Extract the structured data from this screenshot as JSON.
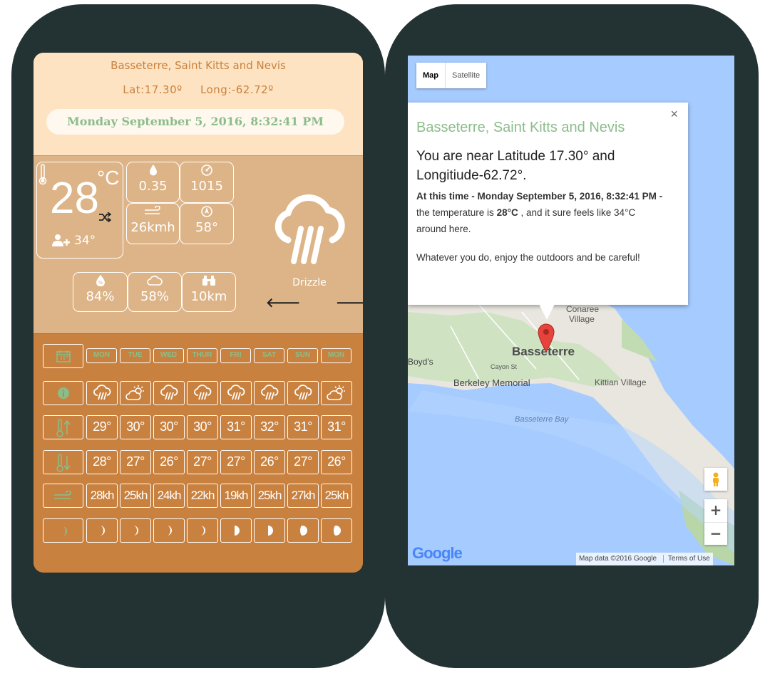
{
  "weather": {
    "location": "Basseterre, Saint Kitts and Nevis",
    "lat": "Lat:17.30º",
    "long": "Long:-62.72º",
    "datetime": "Monday September 5, 2016, 8:32:41 PM",
    "temperature": "28",
    "temp_unit": "°C",
    "feels_like": "34°",
    "precip": "0.35",
    "pressure": "1015",
    "wind_speed": "26kmh",
    "wind_dir": "58°",
    "humidity": "84%",
    "cloud_cover": "58%",
    "visibility": "10km",
    "condition": "Drizzle",
    "nav": {
      "prev": "🡐",
      "next": "🡒"
    }
  },
  "forecast": {
    "days": [
      "MON",
      "TUE",
      "WED",
      "THUR",
      "FRI",
      "SAT",
      "SUN",
      "MON"
    ],
    "icons": [
      "drizzle",
      "drizzle",
      "partly-cloudy",
      "drizzle",
      "drizzle",
      "drizzle",
      "drizzle",
      "drizzle",
      "partly-cloudy"
    ],
    "highs": [
      "29°",
      "30°",
      "30°",
      "30°",
      "31°",
      "32°",
      "31°",
      "31°"
    ],
    "lows": [
      "28°",
      "27°",
      "26°",
      "27°",
      "27°",
      "26°",
      "27°",
      "26°"
    ],
    "winds": [
      "28kh",
      "25kh",
      "24kh",
      "22kh",
      "19kh",
      "25kh",
      "27kh",
      "25kh"
    ],
    "moons": [
      "waxing-crescent",
      "waxing-crescent",
      "waxing-crescent",
      "waxing-crescent",
      "first-quarter",
      "first-quarter",
      "waxing-gibbous",
      "waxing-gibbous"
    ]
  },
  "map": {
    "type_map": "Map",
    "type_satellite": "Satellite",
    "info_title": "Basseterre, Saint Kitts and Nevis",
    "info_near": "You are near Latitude 17.30° and Longitiude-62.72°.",
    "info_bold": "At this time - Monday September 5, 2016, 8:32:41 PM -",
    "info_mid": " the temperature is ",
    "info_temp": "28°C",
    "info_end": " , and it sure feels like 34°C around here.",
    "info_para2": "Whatever you do, enjoy the outdoors and be careful!",
    "close": "×",
    "places": {
      "conaree": "Conaree",
      "village": "Village",
      "basseterre": "Basseterre",
      "boyds": "Boyd's",
      "cayon": "Cayon St",
      "berkeley": "Berkeley Memorial",
      "kittian": "Kittian Village",
      "bay": "Basseterre Bay"
    },
    "zoom_in": "+",
    "zoom_out": "−",
    "google": "Google",
    "attribution": "Map data ©2016 Google",
    "terms": "Terms of Use"
  }
}
